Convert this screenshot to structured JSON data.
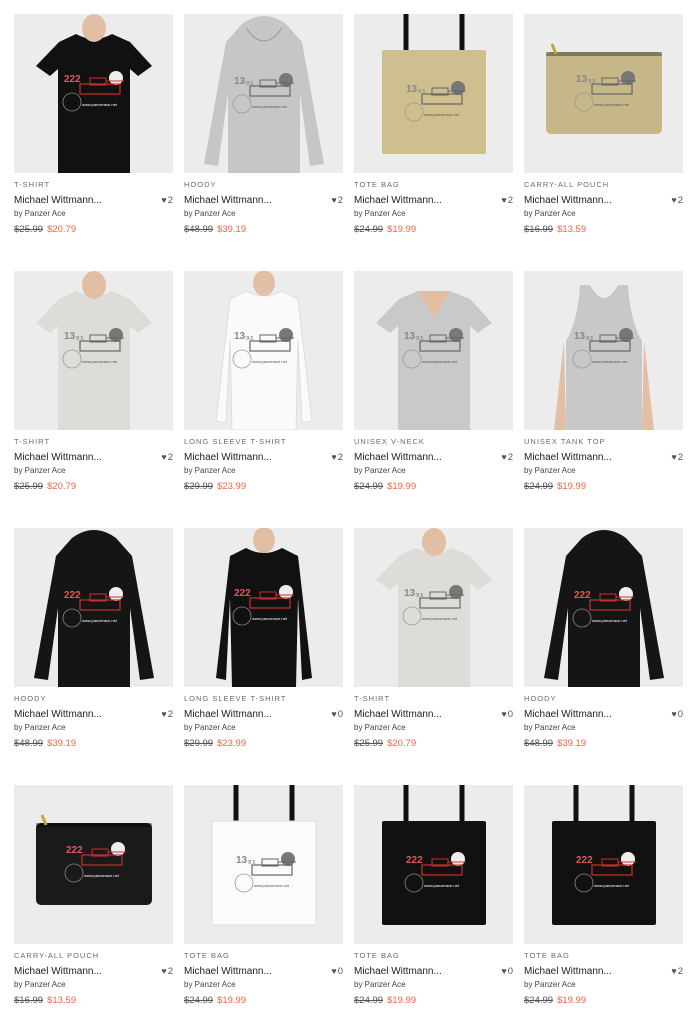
{
  "products": [
    {
      "category": "T-SHIRT",
      "title": "Michael Wittmann...",
      "artist": "by Panzer Ace",
      "likes": "2",
      "old_price": "$25.99",
      "new_price": "$20.79",
      "icon": "tshirt-black-icon"
    },
    {
      "category": "HOODY",
      "title": "Michael Wittmann...",
      "artist": "by Panzer Ace",
      "likes": "2",
      "old_price": "$48.99",
      "new_price": "$39.19",
      "icon": "hoody-grey-back-icon"
    },
    {
      "category": "TOTE BAG",
      "title": "Michael Wittmann...",
      "artist": "by Panzer Ace",
      "likes": "2",
      "old_price": "$24.99",
      "new_price": "$19.99",
      "icon": "tote-bag-khaki-icon"
    },
    {
      "category": "CARRY-ALL POUCH",
      "title": "Michael Wittmann...",
      "artist": "by Panzer Ace",
      "likes": "2",
      "old_price": "$16.99",
      "new_price": "$13.59",
      "icon": "pouch-khaki-icon"
    },
    {
      "category": "T-SHIRT",
      "title": "Michael Wittmann...",
      "artist": "by Panzer Ace",
      "likes": "2",
      "old_price": "$25.99",
      "new_price": "$20.79",
      "icon": "tshirt-light-icon"
    },
    {
      "category": "LONG SLEEVE T-SHIRT",
      "title": "Michael Wittmann...",
      "artist": "by Panzer Ace",
      "likes": "2",
      "old_price": "$29.99",
      "new_price": "$23.99",
      "icon": "longsleeve-white-icon"
    },
    {
      "category": "UNISEX V-NECK",
      "title": "Michael Wittmann...",
      "artist": "by Panzer Ace",
      "likes": "2",
      "old_price": "$24.99",
      "new_price": "$19.99",
      "icon": "vneck-grey-icon"
    },
    {
      "category": "UNISEX TANK TOP",
      "title": "Michael Wittmann...",
      "artist": "by Panzer Ace",
      "likes": "2",
      "old_price": "$24.99",
      "new_price": "$19.99",
      "icon": "tanktop-grey-icon"
    },
    {
      "category": "HOODY",
      "title": "Michael Wittmann...",
      "artist": "by Panzer Ace",
      "likes": "2",
      "old_price": "$48.99",
      "new_price": "$39.19",
      "icon": "hoody-black-icon"
    },
    {
      "category": "LONG SLEEVE T-SHIRT",
      "title": "Michael Wittmann...",
      "artist": "by Panzer Ace",
      "likes": "0",
      "old_price": "$29.99",
      "new_price": "$23.99",
      "icon": "longsleeve-black-icon"
    },
    {
      "category": "T-SHIRT",
      "title": "Michael Wittmann...",
      "artist": "by Panzer Ace",
      "likes": "0",
      "old_price": "$25.99",
      "new_price": "$20.79",
      "icon": "tshirt-light-icon"
    },
    {
      "category": "HOODY",
      "title": "Michael Wittmann...",
      "artist": "by Panzer Ace",
      "likes": "0",
      "old_price": "$48.99",
      "new_price": "$39.19",
      "icon": "hoody-black-icon"
    },
    {
      "category": "CARRY-ALL POUCH",
      "title": "Michael Wittmann...",
      "artist": "by Panzer Ace",
      "likes": "2",
      "old_price": "$16.99",
      "new_price": "$13.59",
      "icon": "pouch-black-icon"
    },
    {
      "category": "TOTE BAG",
      "title": "Michael Wittmann...",
      "artist": "by Panzer Ace",
      "likes": "0",
      "old_price": "$24.99",
      "new_price": "$19.99",
      "icon": "tote-bag-white-icon"
    },
    {
      "category": "TOTE BAG",
      "title": "Michael Wittmann...",
      "artist": "by Panzer Ace",
      "likes": "0",
      "old_price": "$24.99",
      "new_price": "$19.99",
      "icon": "tote-bag-black-icon"
    },
    {
      "category": "TOTE BAG",
      "title": "Michael Wittmann...",
      "artist": "by Panzer Ace",
      "likes": "2",
      "old_price": "$24.99",
      "new_price": "$19.99",
      "icon": "tote-bag-black-icon"
    }
  ],
  "heart_glyph": "♥",
  "colors": {
    "sale_price": "#f06445",
    "product_bg": "#ececec"
  }
}
